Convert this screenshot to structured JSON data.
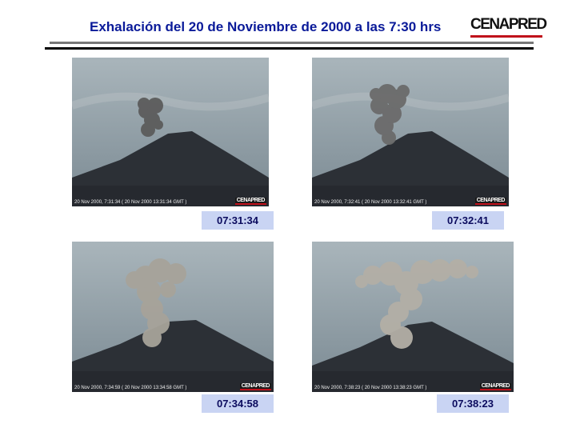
{
  "header": {
    "title": "Exhalación del 20 de Noviembre de 2000 a las 7:30 hrs",
    "logo_text": "CENAPRED",
    "logo_accent": "#c0101a",
    "title_color": "#0a1a99"
  },
  "frames": [
    {
      "time": "07:31:34",
      "stamp": "20  Nov  2000,  7:31:34  ( 20 Nov 2000  13:31:34  GMT )",
      "watermark": "CENAPRED",
      "plume": "small"
    },
    {
      "time": "07:32:41",
      "stamp": "20  Nov  2000,  7:32:41  ( 20 Nov 2000  13:32:41  GMT )",
      "watermark": "CENAPRED",
      "plume": "medium"
    },
    {
      "time": "07:34:58",
      "stamp": "20  Nov  2000,  7:34:59  ( 20 Nov 2000  13:34:58  GMT )",
      "watermark": "CENAPRED",
      "plume": "large"
    },
    {
      "time": "07:38:23",
      "stamp": "20  Nov  2000,  7:38:23  ( 20 Nov 2000  13:38:23  GMT )",
      "watermark": "CENAPRED",
      "plume": "spreading"
    }
  ],
  "colors": {
    "time_label_bg": "#c9d4f3",
    "time_label_text": "#0b0b5e"
  }
}
